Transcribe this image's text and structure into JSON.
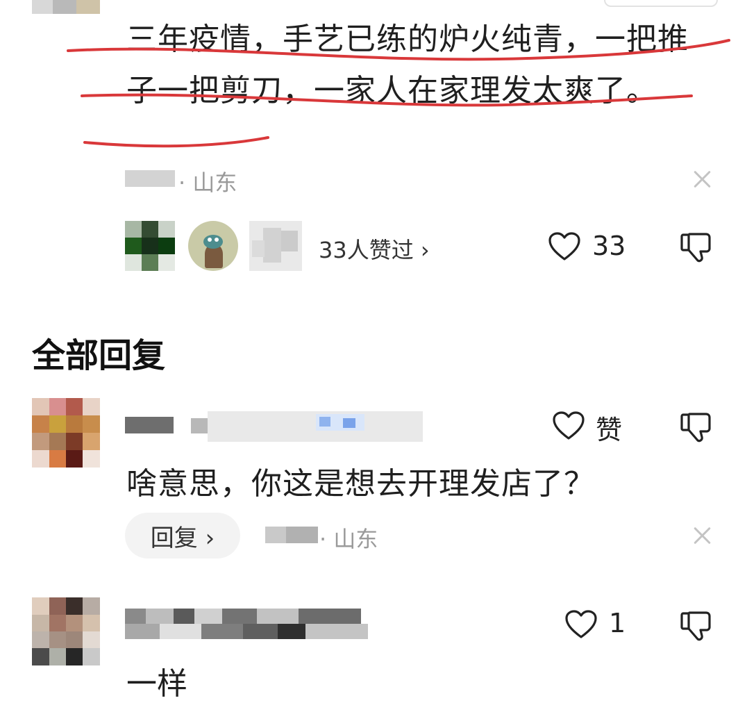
{
  "post": {
    "text": "三年疫情，手艺已练的炉火纯青，一把推子一把剪刀，一家人在家理发太爽了。",
    "location": "· 山东",
    "liked_by_label": "33人赞过 ›",
    "like_count": "33"
  },
  "section_title": "全部回复",
  "replies": [
    {
      "text": "啥意思，你这是想去开理发店了？",
      "like_label": "赞",
      "reply_button": "回复 ›",
      "location": "· 山东"
    },
    {
      "text": "一样",
      "like_count": "1"
    }
  ],
  "icons": {
    "heart": "heart-icon",
    "dislike": "thumbs-down-icon",
    "close": "close-icon"
  },
  "colors": {
    "annotation_underline": "#d9383a",
    "meta_gray": "#9a9a9a"
  }
}
